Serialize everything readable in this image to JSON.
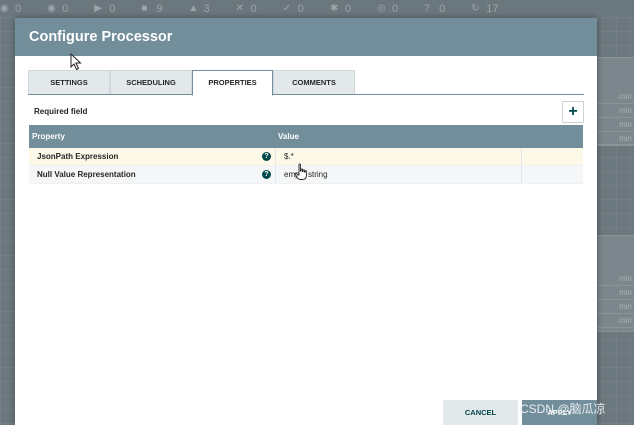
{
  "statusbar": {
    "items": [
      {
        "icon": "bulletin-icon",
        "value": "0"
      },
      {
        "icon": "transmitting-icon",
        "value": "0"
      },
      {
        "icon": "running-icon",
        "value": "0"
      },
      {
        "icon": "stopped-icon",
        "value": "9"
      },
      {
        "icon": "invalid-icon",
        "value": "3"
      },
      {
        "icon": "disabled-icon",
        "value": "0"
      },
      {
        "icon": "up-to-date-icon",
        "value": "0"
      },
      {
        "icon": "locally-modified-icon",
        "value": "0"
      },
      {
        "icon": "stale-icon",
        "value": "0"
      },
      {
        "icon": "sync-failure-icon",
        "value": "0"
      },
      {
        "icon": "refresh-icon",
        "value": "17"
      }
    ]
  },
  "background_rows": {
    "proc1": [
      "min",
      "min",
      "min",
      "min"
    ],
    "proc2": [
      "min",
      "min",
      "min",
      "min"
    ]
  },
  "modal": {
    "title": "Configure Processor",
    "tabs": [
      {
        "label": "SETTINGS",
        "active": false
      },
      {
        "label": "SCHEDULING",
        "active": false
      },
      {
        "label": "PROPERTIES",
        "active": true
      },
      {
        "label": "COMMENTS",
        "active": false
      }
    ],
    "required_label": "Required field",
    "add_icon": "+",
    "table": {
      "headers": {
        "property": "Property",
        "value": "Value"
      },
      "rows": [
        {
          "property": "JsonPath Expression",
          "value": "$.*",
          "help": "?"
        },
        {
          "property": "Null Value Representation",
          "value": "empty string",
          "help": "?"
        }
      ]
    },
    "cancel_label": "CANCEL",
    "apply_label": "APPLY"
  },
  "watermark": "CSDN @脑瓜凉",
  "colors": {
    "header": "#728e9b",
    "accent": "#004849",
    "selected_row": "#fdf9e9"
  }
}
